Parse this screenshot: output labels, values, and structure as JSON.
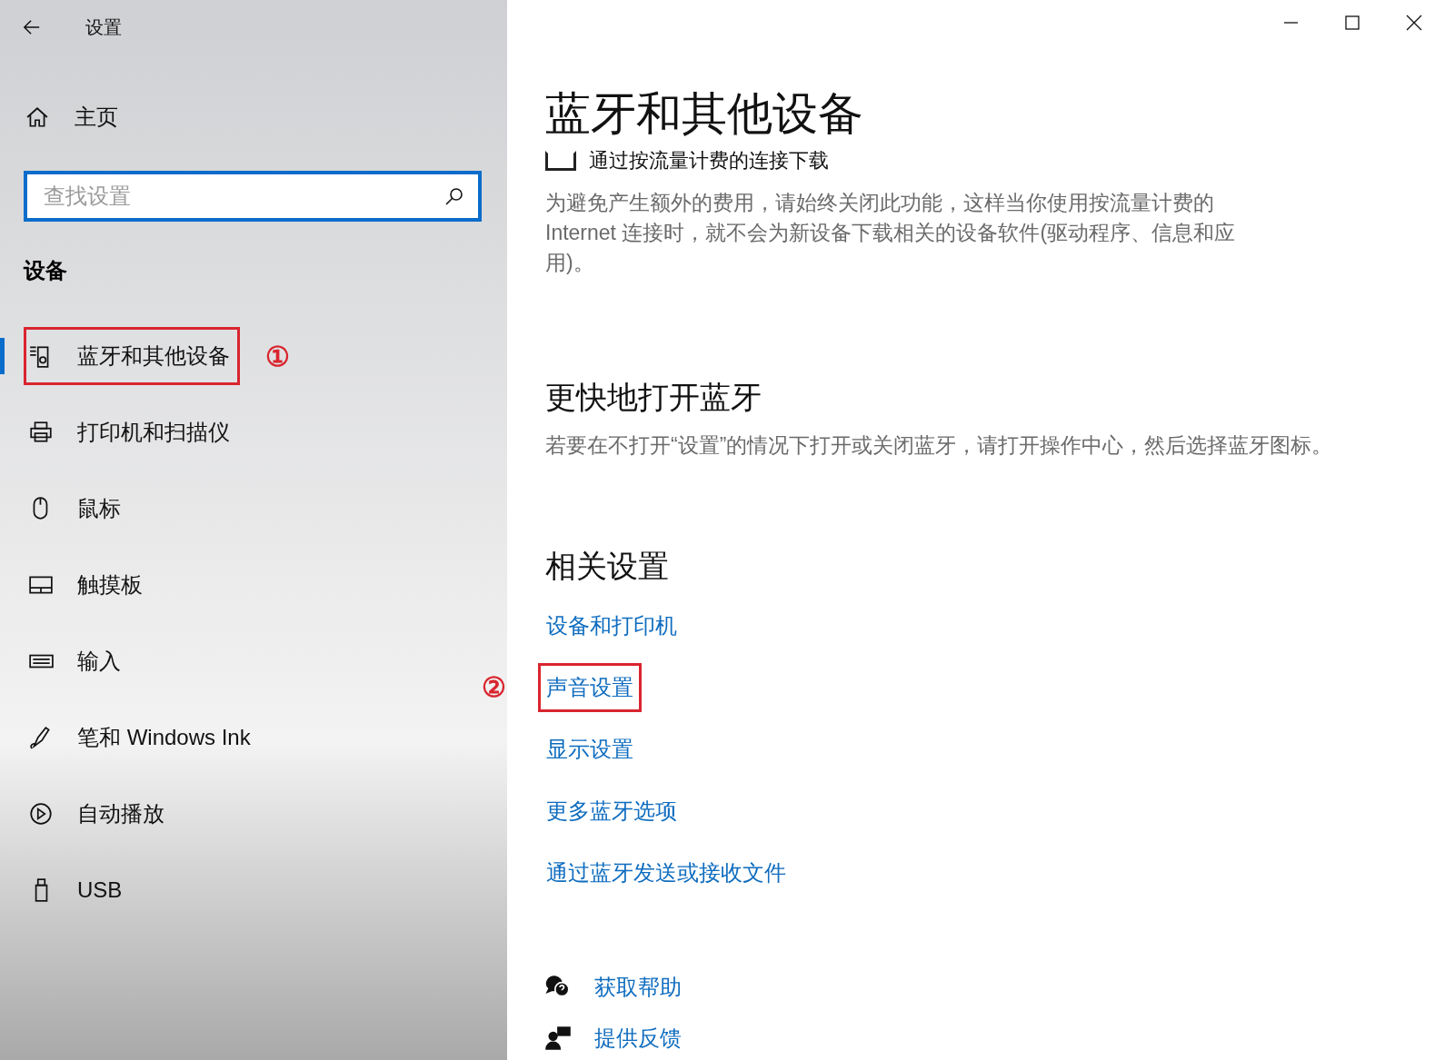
{
  "window": {
    "title": "设置"
  },
  "sidebar": {
    "home": "主页",
    "search": {
      "placeholder": "查找设置"
    },
    "section": "设备",
    "items": [
      {
        "label": "蓝牙和其他设备",
        "selected": true,
        "annotation": "①"
      },
      {
        "label": "打印机和扫描仪",
        "selected": false
      },
      {
        "label": "鼠标",
        "selected": false
      },
      {
        "label": "触摸板",
        "selected": false
      },
      {
        "label": "输入",
        "selected": false
      },
      {
        "label": "笔和 Windows Ink",
        "selected": false
      },
      {
        "label": "自动播放",
        "selected": false
      },
      {
        "label": "USB",
        "selected": false
      }
    ]
  },
  "main": {
    "title": "蓝牙和其他设备",
    "metered": {
      "label": "通过按流量计费的连接下载",
      "checked": false,
      "description": "为避免产生额外的费用，请始终关闭此功能，这样当你使用按流量计费的 Internet 连接时，就不会为新设备下载相关的设备软件(驱动程序、信息和应用)。"
    },
    "quick": {
      "heading": "更快地打开蓝牙",
      "text": "若要在不打开“设置”的情况下打开或关闭蓝牙，请打开操作中心，然后选择蓝牙图标。"
    },
    "related": {
      "heading": "相关设置",
      "links": [
        {
          "label": "设备和打印机"
        },
        {
          "label": "声音设置",
          "annotation": "②"
        },
        {
          "label": "显示设置"
        },
        {
          "label": "更多蓝牙选项"
        },
        {
          "label": "通过蓝牙发送或接收文件"
        }
      ]
    },
    "help": [
      {
        "label": "获取帮助"
      },
      {
        "label": "提供反馈"
      }
    ]
  }
}
